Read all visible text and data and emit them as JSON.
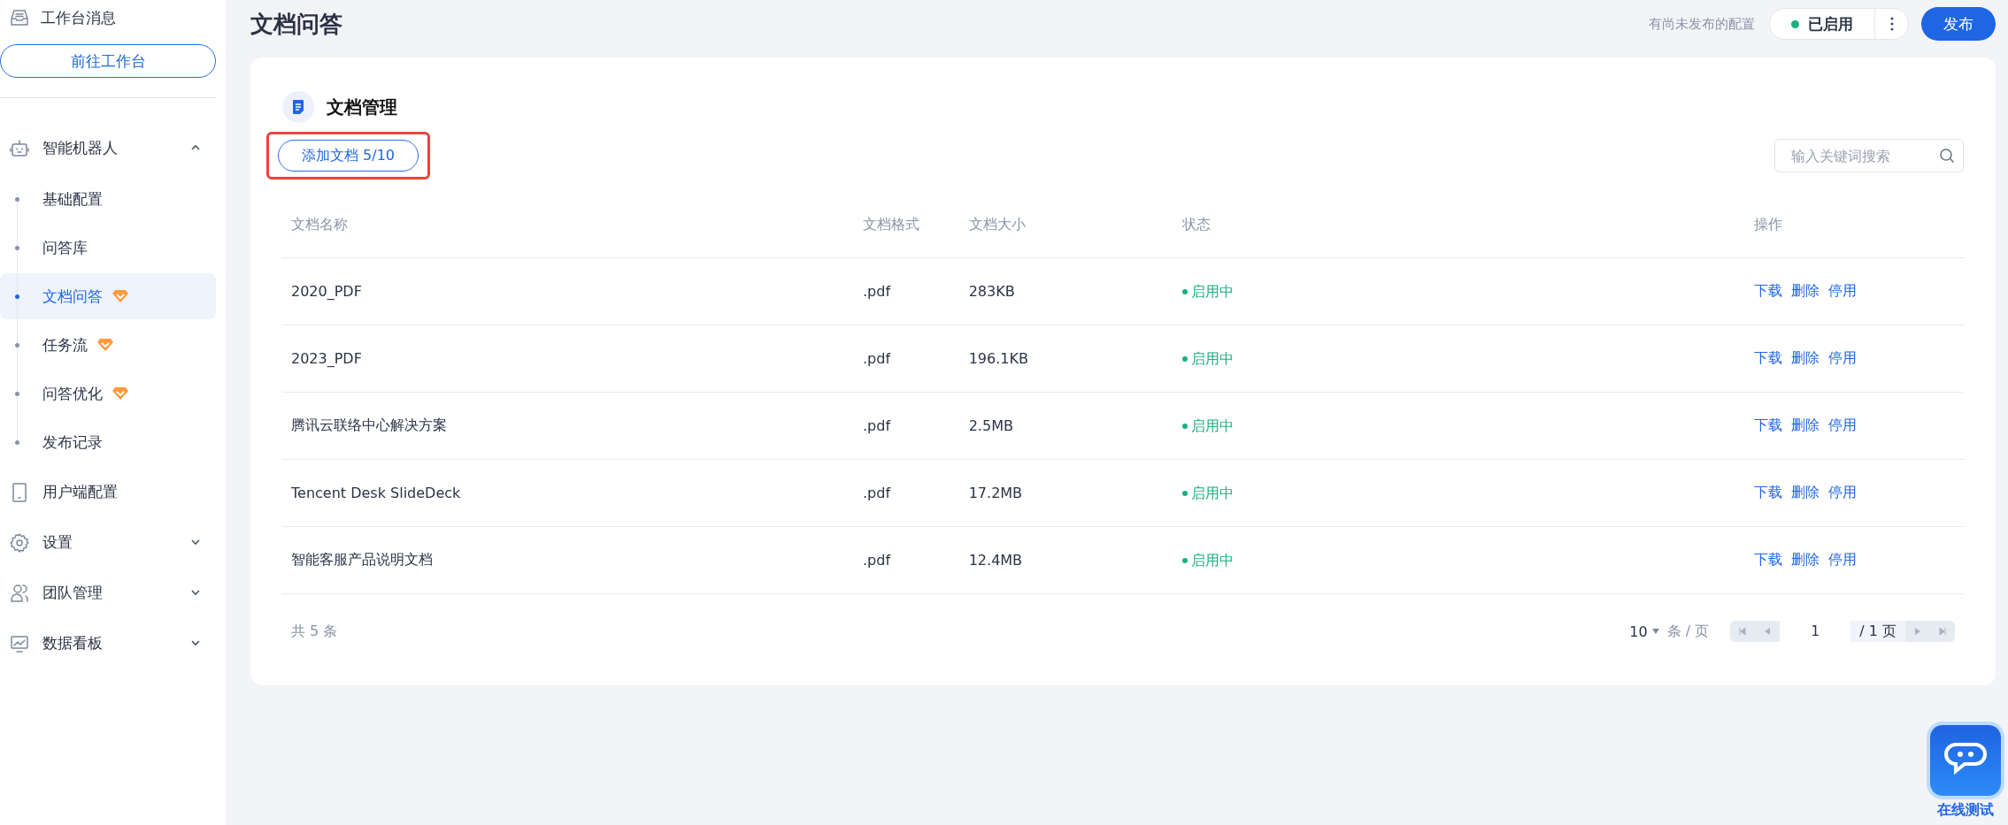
{
  "sidebar": {
    "notice": "工作台消息",
    "workbench_button": "前往工作台",
    "items": [
      {
        "label": "智能机器人",
        "expanded": true,
        "children": [
          {
            "label": "基础配置",
            "selected": false,
            "premium": false
          },
          {
            "label": "问答库",
            "selected": false,
            "premium": false
          },
          {
            "label": "文档问答",
            "selected": true,
            "premium": true
          },
          {
            "label": "任务流",
            "selected": false,
            "premium": true
          },
          {
            "label": "问答优化",
            "selected": false,
            "premium": true
          },
          {
            "label": "发布记录",
            "selected": false,
            "premium": false
          }
        ]
      },
      {
        "label": "用户端配置"
      },
      {
        "label": "设置",
        "expanded": false
      },
      {
        "label": "团队管理",
        "expanded": false
      },
      {
        "label": "数据看板",
        "expanded": false
      }
    ]
  },
  "header": {
    "title": "文档问答",
    "hint": "有尚未发布的配置",
    "status": "已启用",
    "publish": "发布"
  },
  "card": {
    "title": "文档管理",
    "add_button": "添加文档 5/10",
    "search": {
      "placeholder": "输入关键词搜索"
    },
    "table": {
      "columns": [
        "文档名称",
        "文档格式",
        "文档大小",
        "状态",
        "操作"
      ],
      "rows": [
        {
          "name": "2020_PDF",
          "format": ".pdf",
          "size": "283KB",
          "status": "启用中",
          "actions": [
            "下载",
            "删除",
            "停用"
          ]
        },
        {
          "name": "2023_PDF",
          "format": ".pdf",
          "size": "196.1KB",
          "status": "启用中",
          "actions": [
            "下载",
            "删除",
            "停用"
          ]
        },
        {
          "name": "腾讯云联络中心解决方案",
          "format": ".pdf",
          "size": "2.5MB",
          "status": "启用中",
          "actions": [
            "下载",
            "删除",
            "停用"
          ]
        },
        {
          "name": "Tencent Desk SlideDeck",
          "format": ".pdf",
          "size": "17.2MB",
          "status": "启用中",
          "actions": [
            "下载",
            "删除",
            "停用"
          ]
        },
        {
          "name": "智能客服产品说明文档",
          "format": ".pdf",
          "size": "12.4MB",
          "status": "启用中",
          "actions": [
            "下载",
            "删除",
            "停用"
          ]
        }
      ]
    },
    "footer": {
      "total": "共 5 条",
      "page_size": "10",
      "unit": "条 / 页",
      "page": "1",
      "pages": "/ 1 页"
    }
  },
  "test_button": "在线测试"
}
